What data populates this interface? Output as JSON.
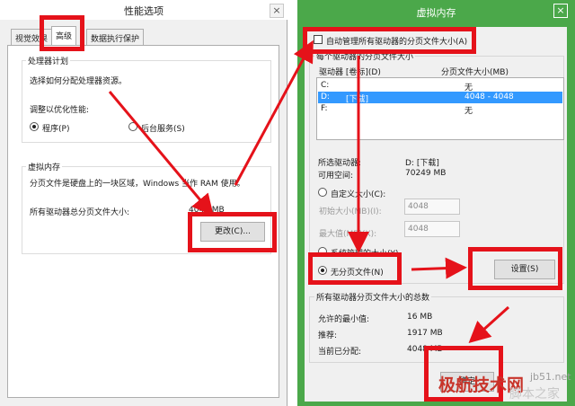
{
  "left_window": {
    "title": "性能选项",
    "tabs": [
      "视觉效果",
      "高级",
      "数据执行保护"
    ],
    "processor": {
      "group_title": "处理器计划",
      "description": "选择如何分配处理器资源。",
      "adjust_label": "调整以优化性能:",
      "option_programs": "程序(P)",
      "option_background": "后台服务(S)"
    },
    "virtual_memory": {
      "group_title": "虚拟内存",
      "description": "分页文件是硬盘上的一块区域，Windows 当作 RAM 使用。",
      "total_label": "所有驱动器总分页文件大小:",
      "total_value": "4048 MB",
      "change_button": "更改(C)..."
    }
  },
  "right_window": {
    "title": "虚拟内存",
    "close_glyph": "×",
    "auto_manage_label": "自动管理所有驱动器的分页文件大小(A)",
    "per_drive_title": "每个驱动器的分页文件大小",
    "columns": [
      "驱动器 [卷标](D)",
      "分页文件大小(MB)"
    ],
    "drives": [
      {
        "drive": "C:",
        "label": "",
        "size": "无"
      },
      {
        "drive": "D:",
        "label": "[下载]",
        "size": "4048 - 4048"
      },
      {
        "drive": "F:",
        "label": "",
        "size": "无"
      }
    ],
    "selected_drive_label": "所选驱动器:",
    "selected_drive_value": "D:  [下载]",
    "free_space_label": "可用空间:",
    "free_space_value": "70249 MB",
    "custom_size_label": "自定义大小(C):",
    "initial_size_label": "初始大小(MB)(I):",
    "initial_size_value": "4048",
    "max_size_label": "最大值(MB)(X):",
    "max_size_value": "4048",
    "system_managed_label": "系统管理的大小(Y)",
    "no_paging_label": "无分页文件(N)",
    "set_button": "设置(S)",
    "totals_title": "所有驱动器分页文件大小的总数",
    "min_allowed_label": "允许的最小值:",
    "min_allowed_value": "16 MB",
    "recommended_label": "推荐:",
    "recommended_value": "1917 MB",
    "current_label": "当前已分配:",
    "current_value": "4048 MB",
    "ok_button": "确定"
  },
  "watermark": {
    "text1": "极航技术网",
    "text2": "jb51.net",
    "text3": "脚本之家"
  },
  "colors": {
    "annotation_red": "#e5121a",
    "titlebar_green": "#4ba84a",
    "selection_blue": "#3399ff"
  }
}
